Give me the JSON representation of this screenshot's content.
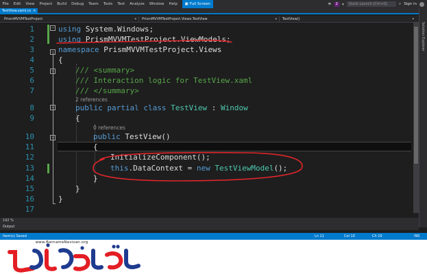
{
  "menu": {
    "items": [
      "File",
      "Edit",
      "View",
      "Project",
      "Build",
      "Debug",
      "Team",
      "Tools",
      "Test",
      "Analyze",
      "Window",
      "Help"
    ],
    "full_screen": "Full Screen",
    "notification_count": "2",
    "quick_launch_placeholder": "Quick Launch (Ctrl+Q)",
    "sign_in": "Sign in"
  },
  "tab": {
    "label": "TestView.xaml.cs",
    "close_glyph": "✕"
  },
  "navbar": {
    "project": "PrismMVVMTestProject",
    "class": "PrismMVVMTestProject.Views.TestView",
    "member": "TestView()"
  },
  "side_panel": {
    "label": "Solution Explorer"
  },
  "code": {
    "line_numbers": [
      "1",
      "2",
      "3",
      "4",
      "5",
      "6",
      "7",
      "8",
      "9",
      "10",
      "11",
      "12",
      "13",
      "14",
      "15",
      "16",
      "17"
    ],
    "lines": {
      "l1": [
        "using",
        " System.Windows;"
      ],
      "l2": [
        "using",
        " PrismMVVMTestProject.ViewModels;"
      ],
      "l3": [
        "namespace",
        " PrismMVVMTestProject.Views"
      ],
      "l4": "{",
      "l5": "/// <summary>",
      "l6": "/// Interaction logic for TestView.xaml",
      "l7": "/// </summary>",
      "l8": [
        "public",
        " ",
        "partial",
        " ",
        "class",
        " ",
        "TestView",
        " : ",
        "Window"
      ],
      "l9": "{",
      "l10": [
        "public",
        " TestView()"
      ],
      "l11": "{",
      "l12": "InitializeComponent();",
      "l13": [
        "this",
        ".DataContext = ",
        "new",
        " ",
        "TestViewModel",
        "();"
      ],
      "l14": "}",
      "l15": "}",
      "l16": "}"
    },
    "codelens_class": "2 references",
    "codelens_ctor": "0 references"
  },
  "zoom": "192 %",
  "output": {
    "label": "Output"
  },
  "status": {
    "message": "Item(s) Saved",
    "ln": "Ln 11",
    "col": "Col 10",
    "ch": "Ch 10",
    "mode": "INS"
  },
  "logo": {
    "url": "www.BarnameNevisan.org",
    "wordmark": "برنامه نویسان"
  },
  "colors": {
    "editor_bg": "#1e1e1e",
    "keyword": "#569cd6",
    "type": "#4ec9b0",
    "comment": "#57a64a",
    "line_number": "#2b91af",
    "accent": "#007acc",
    "annotation": "#e0262b",
    "logo_red": "#e31e24",
    "logo_blue": "#1f3b8f"
  }
}
